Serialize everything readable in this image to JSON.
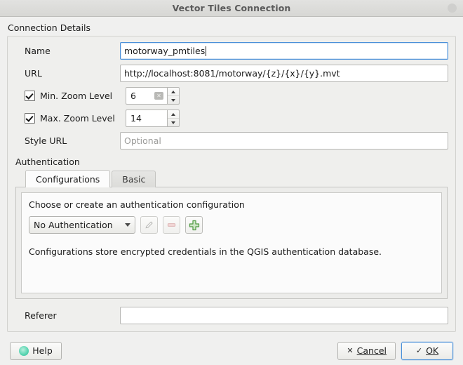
{
  "window": {
    "title": "Vector Tiles Connection",
    "close_icon": "window-close-circle"
  },
  "connection_details": {
    "group_label": "Connection Details",
    "name": {
      "label": "Name",
      "value": "motorway_pmtiles"
    },
    "url": {
      "label": "URL",
      "value": "http://localhost:8081/motorway/{z}/{x}/{y}.mvt"
    },
    "min_zoom": {
      "label": "Min. Zoom Level",
      "checked": true,
      "value": "6",
      "clear_icon": "clear-text-icon",
      "clear_glyph": "✕"
    },
    "max_zoom": {
      "label": "Max. Zoom Level",
      "checked": true,
      "value": "14"
    },
    "style_url": {
      "label": "Style URL",
      "value": "",
      "placeholder": "Optional"
    },
    "authentication": {
      "label": "Authentication",
      "tabs": [
        {
          "label": "Configurations",
          "active": true
        },
        {
          "label": "Basic",
          "active": false
        }
      ],
      "help_text": "Choose or create an authentication configuration",
      "config_select": {
        "value": "No Authentication",
        "arrow_icon": "chevron-down-icon"
      },
      "buttons": [
        {
          "icon": "edit-pencil-icon",
          "enabled": false
        },
        {
          "icon": "remove-minus-icon",
          "enabled": false
        },
        {
          "icon": "add-plus-icon",
          "enabled": true
        }
      ],
      "note": "Configurations store encrypted credentials in the QGIS authentication database."
    },
    "referer": {
      "label": "Referer",
      "value": ""
    }
  },
  "buttonbox": {
    "help": {
      "label": "Help",
      "icon": "help-icon"
    },
    "cancel": {
      "label": "Cancel",
      "mark": "✕",
      "accel": "C"
    },
    "ok": {
      "label": "OK",
      "mark": "✓",
      "accel": "O"
    }
  },
  "colors": {
    "accent": "#4a90d9",
    "add_green": "#4f9a41",
    "help_teal": "#2bbd95",
    "window_bg": "#f0f0ef"
  }
}
